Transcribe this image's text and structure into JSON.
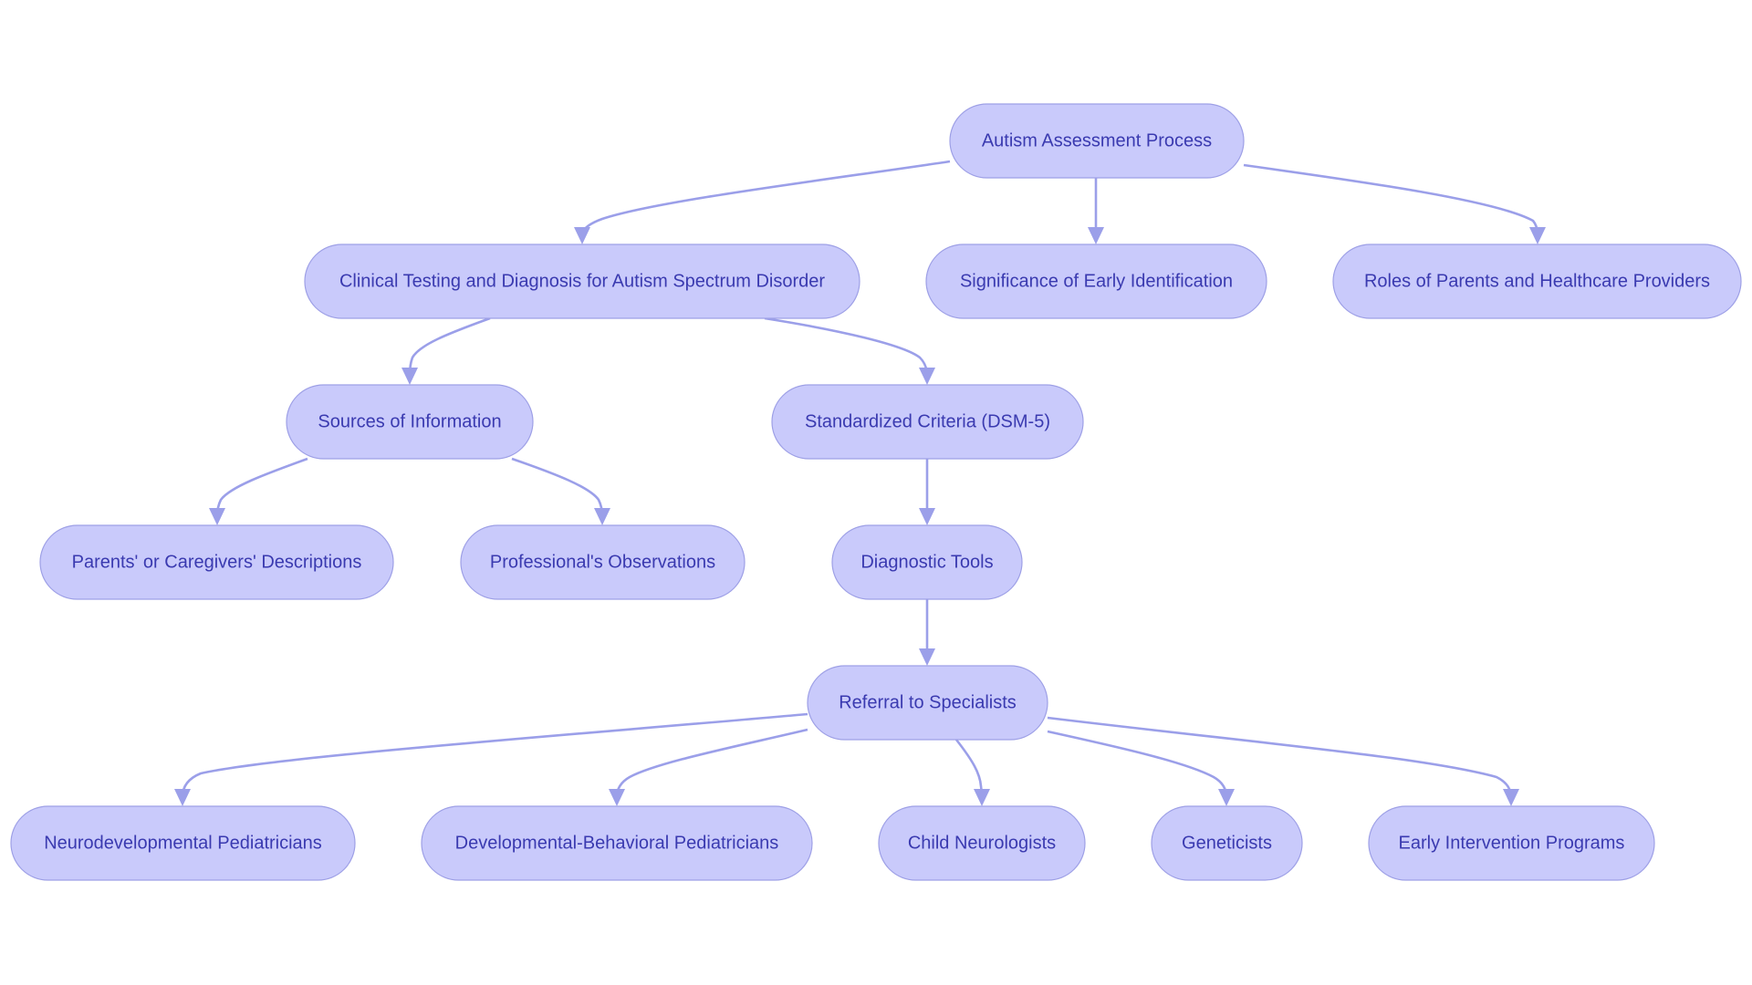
{
  "diagram": {
    "type": "flowchart",
    "colors": {
      "node_fill": "#c9cafb",
      "node_stroke": "#9ea0e6",
      "text": "#3a3ab0",
      "edge": "#9b9fe9"
    },
    "nodes": [
      {
        "id": "root",
        "label": "Autism Assessment Process"
      },
      {
        "id": "clinical",
        "label": "Clinical Testing and Diagnosis for Autism Spectrum Disorder"
      },
      {
        "id": "significance",
        "label": "Significance of Early Identification"
      },
      {
        "id": "roles",
        "label": "Roles of Parents and Healthcare Providers"
      },
      {
        "id": "sources",
        "label": "Sources of Information"
      },
      {
        "id": "criteria",
        "label": "Standardized Criteria (DSM-5)"
      },
      {
        "id": "parents",
        "label": "Parents' or Caregivers' Descriptions"
      },
      {
        "id": "professional",
        "label": "Professional's Observations"
      },
      {
        "id": "tools",
        "label": "Diagnostic Tools"
      },
      {
        "id": "referral",
        "label": "Referral to Specialists"
      },
      {
        "id": "neuro_ped",
        "label": "Neurodevelopmental Pediatricians"
      },
      {
        "id": "devbeh_ped",
        "label": "Developmental-Behavioral Pediatricians"
      },
      {
        "id": "child_neuro",
        "label": "Child Neurologists"
      },
      {
        "id": "geneticists",
        "label": "Geneticists"
      },
      {
        "id": "early_int",
        "label": "Early Intervention Programs"
      }
    ],
    "edges": [
      {
        "from": "root",
        "to": "clinical"
      },
      {
        "from": "root",
        "to": "significance"
      },
      {
        "from": "root",
        "to": "roles"
      },
      {
        "from": "clinical",
        "to": "sources"
      },
      {
        "from": "clinical",
        "to": "criteria"
      },
      {
        "from": "sources",
        "to": "parents"
      },
      {
        "from": "sources",
        "to": "professional"
      },
      {
        "from": "criteria",
        "to": "tools"
      },
      {
        "from": "tools",
        "to": "referral"
      },
      {
        "from": "referral",
        "to": "neuro_ped"
      },
      {
        "from": "referral",
        "to": "devbeh_ped"
      },
      {
        "from": "referral",
        "to": "child_neuro"
      },
      {
        "from": "referral",
        "to": "geneticists"
      },
      {
        "from": "referral",
        "to": "early_int"
      }
    ]
  }
}
